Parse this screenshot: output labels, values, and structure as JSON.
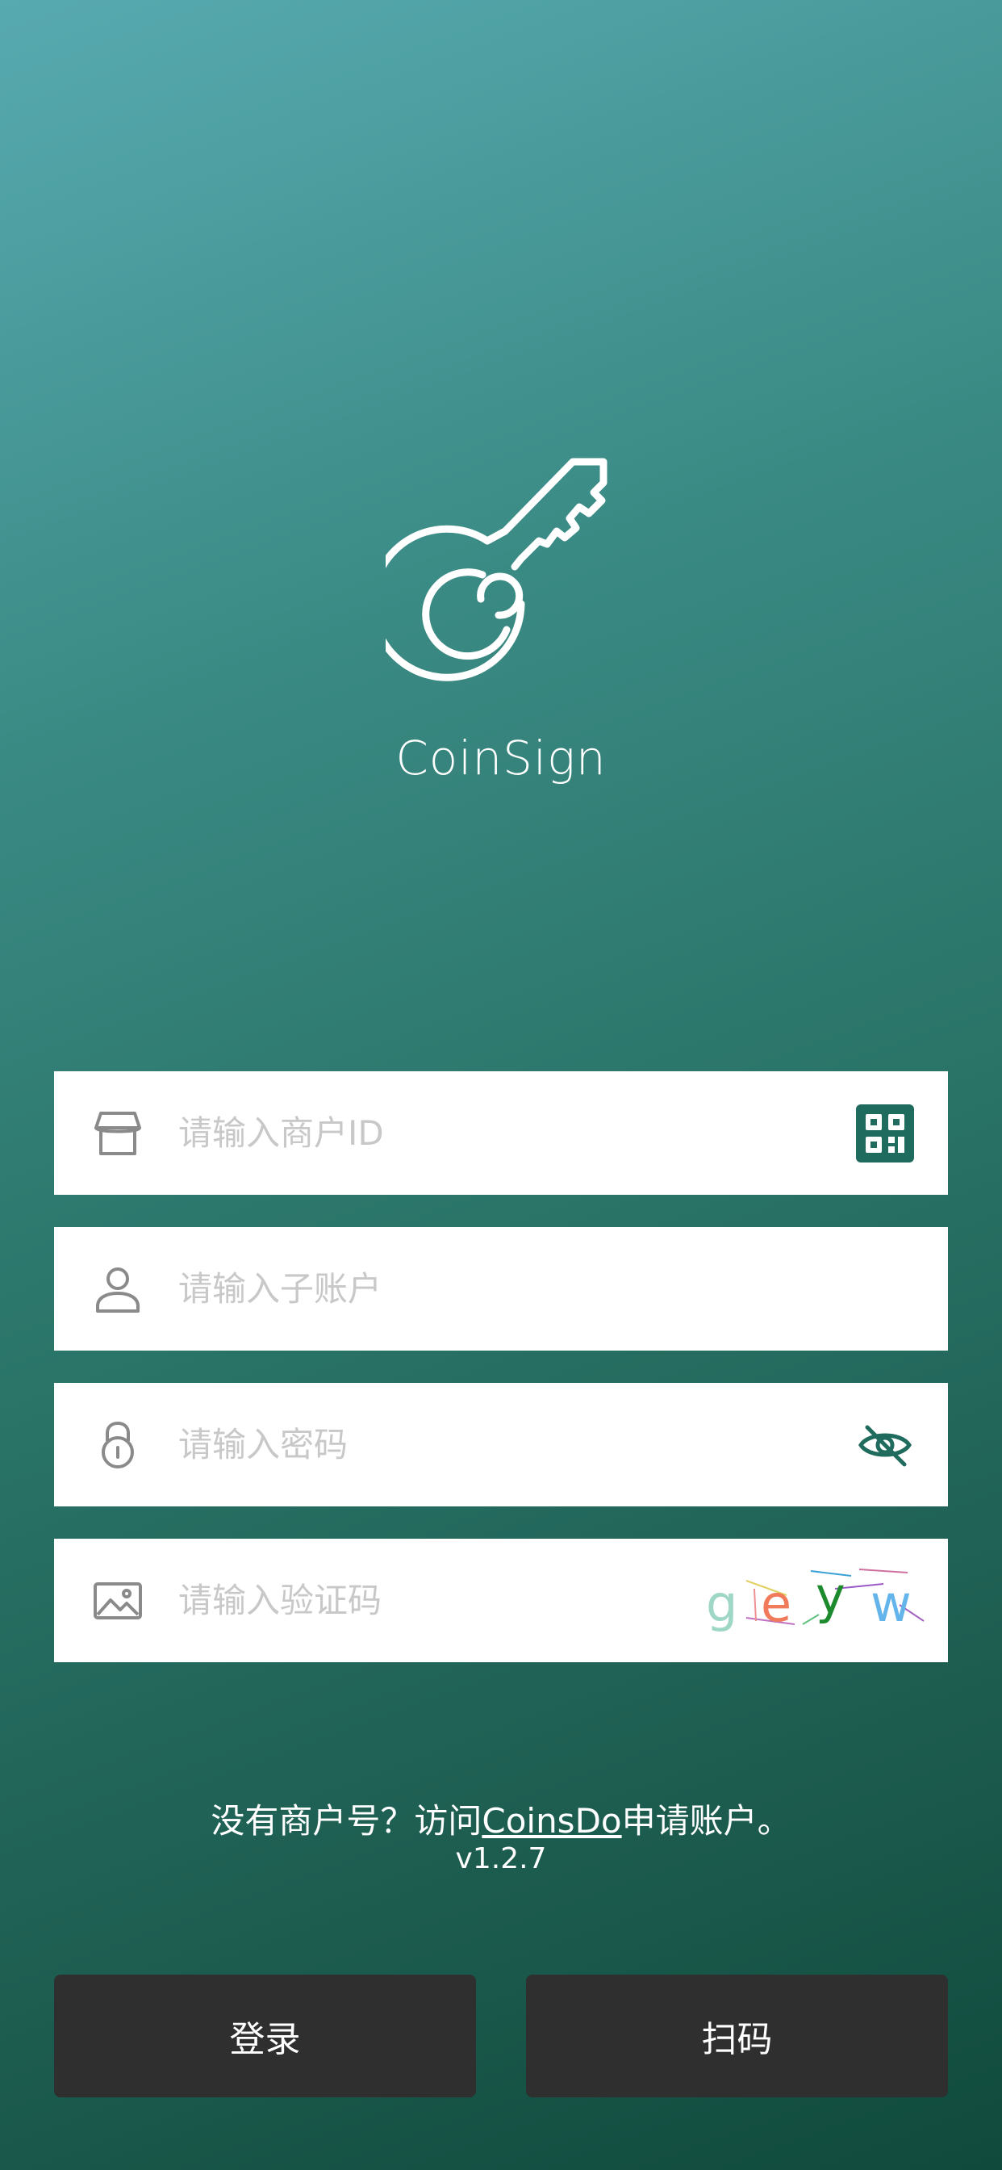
{
  "app": {
    "name": "CoinSign"
  },
  "form": {
    "merchant_id": {
      "placeholder": "请输入商户ID",
      "value": ""
    },
    "sub_account": {
      "placeholder": "请输入子账户",
      "value": ""
    },
    "password": {
      "placeholder": "请输入密码",
      "value": ""
    },
    "captcha": {
      "placeholder": "请输入验证码",
      "value": "",
      "image_text": "geyw",
      "letter_colors": [
        "#9fd7c6",
        "#f07a5a",
        "#1e8a2e",
        "#62b4ea"
      ]
    }
  },
  "footer": {
    "prefix": "没有商户号？访问",
    "link": "CoinsDo",
    "suffix": "申请账户。",
    "version": "v1.2.7"
  },
  "buttons": {
    "login": "登录",
    "scan": "扫码"
  },
  "colors": {
    "accent": "#1f6b5e",
    "button_bg": "#2f2f2f",
    "icon_gray": "#8a8a8a"
  }
}
